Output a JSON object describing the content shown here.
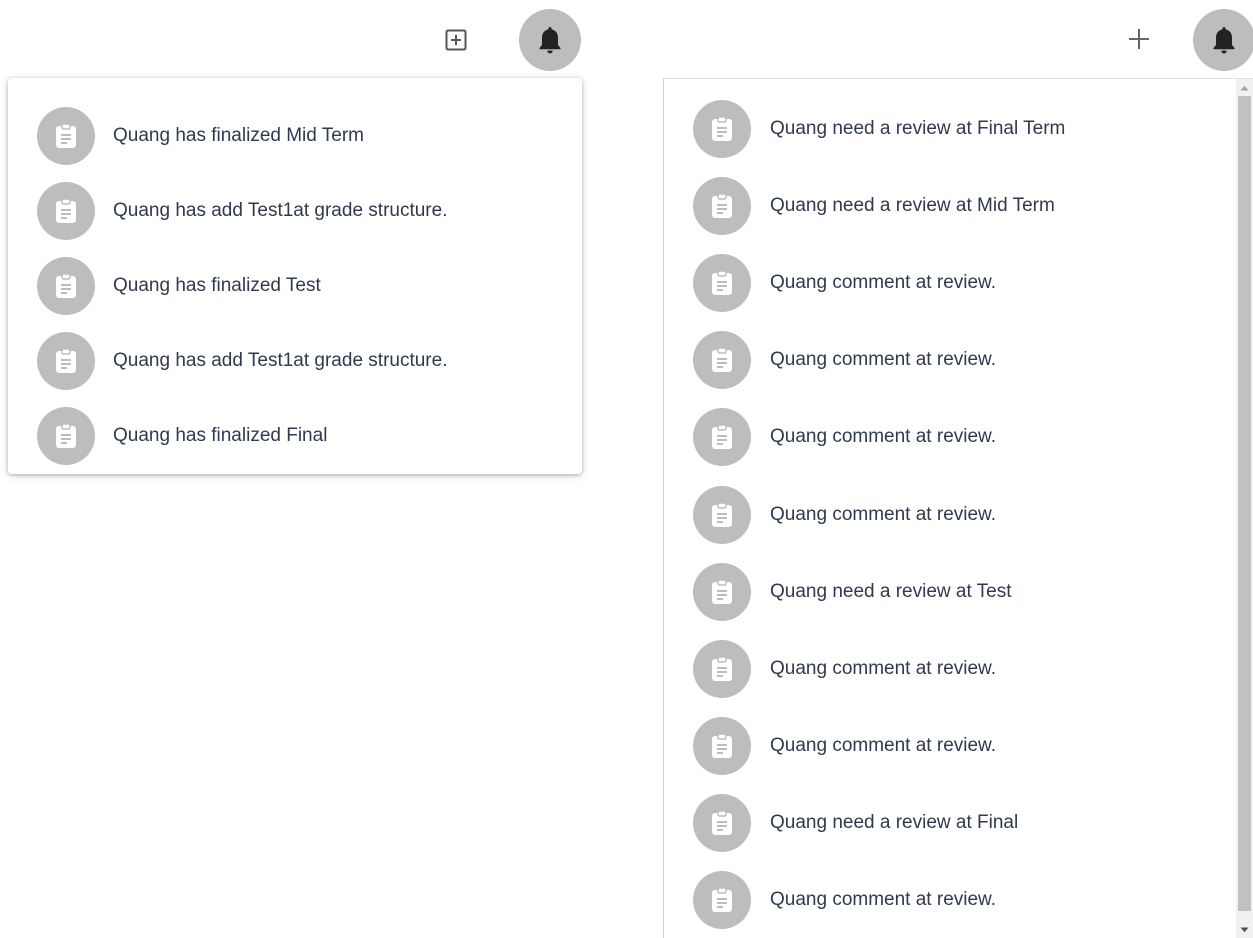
{
  "header": {
    "left_add_icon": "add-box-icon",
    "right_add_icon": "plus-icon",
    "bell_icon": "bell-icon",
    "colors": {
      "avatar_bg": "#bdbdbd",
      "text": "#2f3a4f"
    }
  },
  "left_panel": {
    "items": [
      {
        "text": "Quang has finalized Mid Term",
        "icon": "clipboard-icon"
      },
      {
        "text": "Quang has add Test1at grade structure.",
        "icon": "clipboard-icon"
      },
      {
        "text": "Quang has finalized Test",
        "icon": "clipboard-icon"
      },
      {
        "text": "Quang has add Test1at grade structure.",
        "icon": "clipboard-icon"
      },
      {
        "text": "Quang has finalized Final",
        "icon": "clipboard-icon"
      }
    ]
  },
  "right_panel": {
    "items": [
      {
        "text": "Quang need a review at Final Term",
        "icon": "clipboard-icon"
      },
      {
        "text": "Quang need a review at Mid Term",
        "icon": "clipboard-icon"
      },
      {
        "text": "Quang comment at review.",
        "icon": "clipboard-icon"
      },
      {
        "text": "Quang comment at review.",
        "icon": "clipboard-icon"
      },
      {
        "text": "Quang comment at review.",
        "icon": "clipboard-icon"
      },
      {
        "text": "Quang comment at review.",
        "icon": "clipboard-icon"
      },
      {
        "text": "Quang need a review at Test",
        "icon": "clipboard-icon"
      },
      {
        "text": "Quang comment at review.",
        "icon": "clipboard-icon"
      },
      {
        "text": "Quang comment at review.",
        "icon": "clipboard-icon"
      },
      {
        "text": "Quang need a review at Final",
        "icon": "clipboard-icon"
      },
      {
        "text": "Quang comment at review.",
        "icon": "clipboard-icon"
      }
    ]
  }
}
